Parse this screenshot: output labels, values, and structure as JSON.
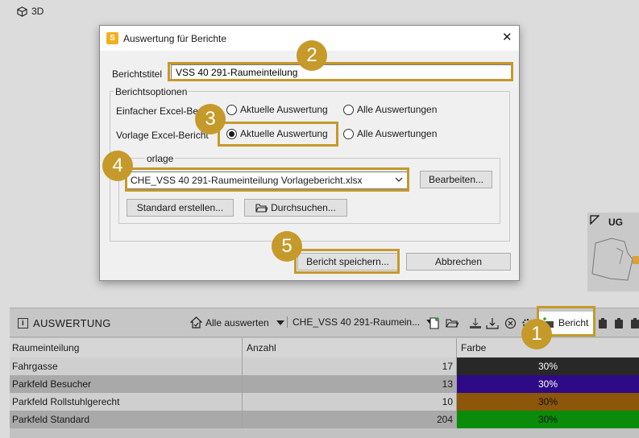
{
  "view": {
    "label": "3D"
  },
  "plan": {
    "level_label": "UG"
  },
  "dialog": {
    "title": "Auswertung für Berichte",
    "app_icon_letter": "S",
    "report_title_label": "Berichtstitel",
    "report_title_value": "VSS 40 291-Raumeinteilung",
    "options_group": "Berichtsoptionen",
    "simple_excel_label": "Einfacher Excel-Beric",
    "template_excel_label": "Vorlage Excel-Bericht",
    "radio_current": "Aktuelle Auswertung",
    "radio_all": "Alle Auswertungen",
    "template_group": "orlage",
    "template_file": "CHE_VSS 40 291-Raumeinteilung Vorlagebericht.xlsx",
    "edit_button": "Bearbeiten...",
    "default_button": "Standard erstellen...",
    "browse_button": "Durchsuchen...",
    "save_button": "Bericht speichern...",
    "cancel_button": "Abbrechen"
  },
  "panel": {
    "title": "AUSWERTUNG",
    "evaluate_all": "Alle auswerten",
    "evaluation_name": "CHE_VSS 40 291-Raumein...",
    "report_button": "Bericht",
    "columns": [
      "Raumeinteilung",
      "Anzahl",
      "Farbe"
    ],
    "rows": [
      {
        "name": "Fahrgasse",
        "count": "17",
        "color_label": "30%",
        "color": "#282828"
      },
      {
        "name": "Parkfeld Besucher",
        "count": "13",
        "color_label": "30%",
        "color": "#2e0a86"
      },
      {
        "name": "Parkfeld Rollstuhlgerecht",
        "count": "10",
        "color_label": "30%",
        "color": "#8c560b"
      },
      {
        "name": "Parkfeld Standard",
        "count": "204",
        "color_label": "30%",
        "color": "#0a8c0a"
      }
    ]
  },
  "callouts": [
    "1",
    "2",
    "3",
    "4",
    "5"
  ],
  "accent_color": "#c59a2b"
}
